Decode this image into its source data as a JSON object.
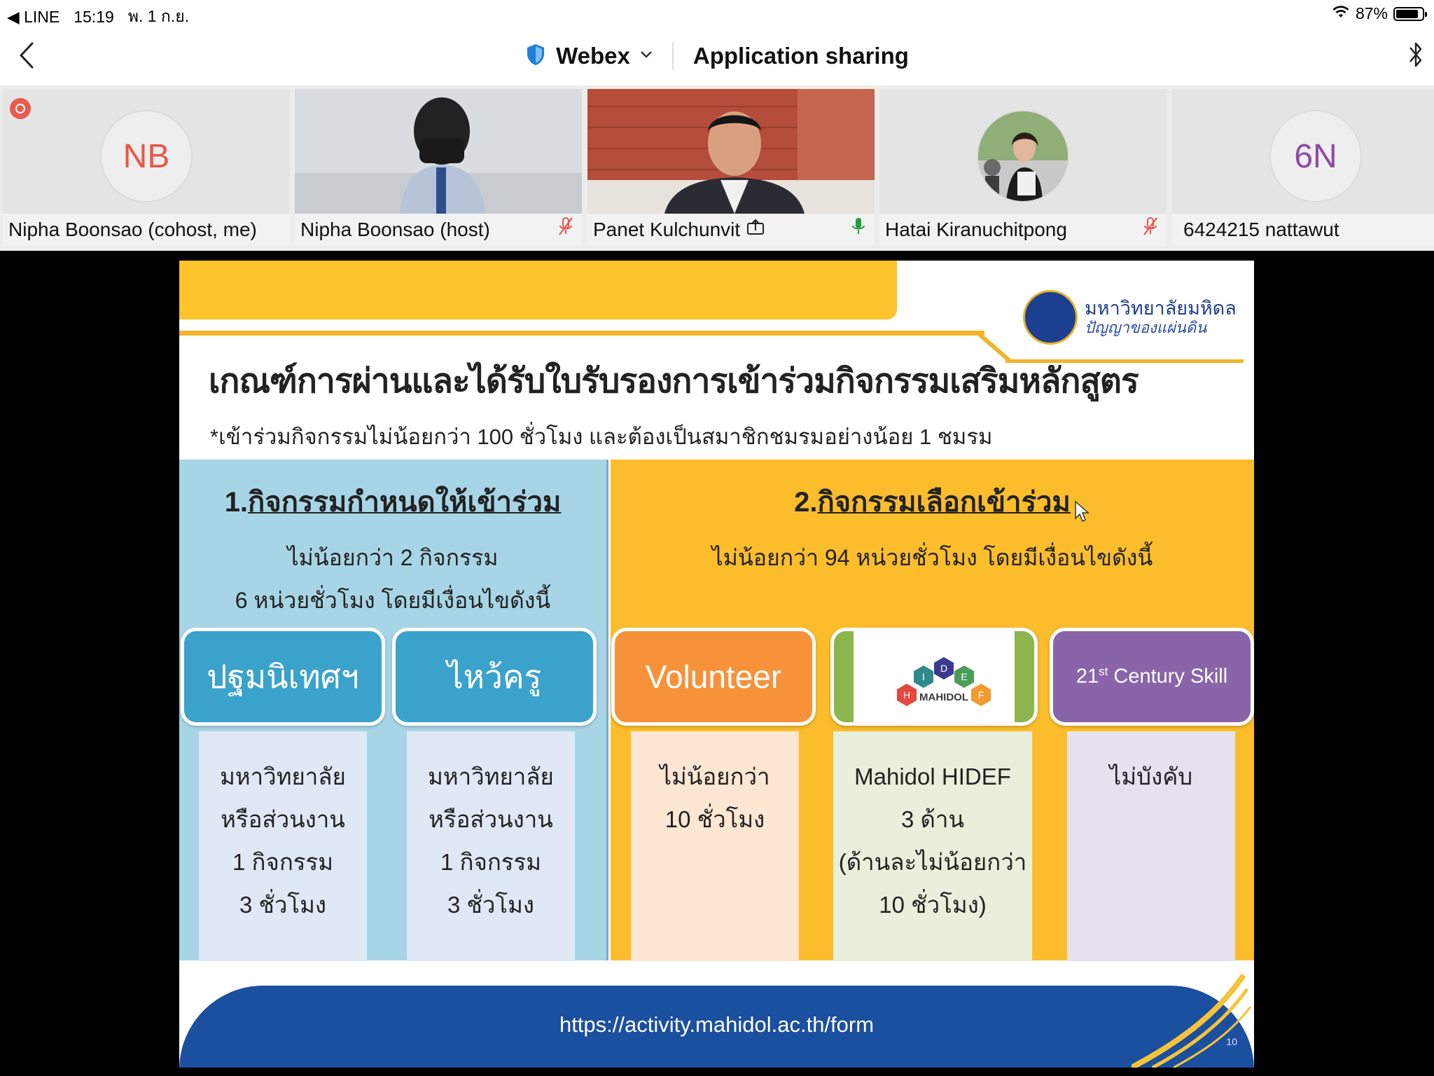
{
  "status_bar": {
    "back_app": "◀ LINE",
    "time": "15:19",
    "date": "พ. 1 ก.ย.",
    "battery_percent": "87%",
    "battery_level": 0.87
  },
  "nav": {
    "webex_label": "Webex",
    "title": "Application sharing"
  },
  "participants": [
    {
      "name": "Nipha Boonsao (cohost, me)",
      "initials": "NB",
      "initials_color": "#e8574a",
      "mic": "none",
      "recording": true
    },
    {
      "name": "Nipha Boonsao (host)",
      "initials": "",
      "mic": "muted"
    },
    {
      "name": "Panet Kulchunvit",
      "initials": "",
      "mic": "active",
      "sharing": true
    },
    {
      "name": "Hatai Kiranuchitpong",
      "initials": "",
      "mic": "muted"
    },
    {
      "name": "6424215 nattawut",
      "initials": "6N",
      "initials_color": "#8e4aa3",
      "mic": "none"
    }
  ],
  "slide": {
    "university_name": "มหาวิทยาลัยมหิดล",
    "university_motto": "ปัญญาของแผ่นดิน",
    "title": "เกณฑ์การผ่านและได้รับใบรับรองการเข้าร่วมกิจกรรมเสริมหลักสูตร",
    "subtitle": "*เข้าร่วมกิจกรรมไม่น้อยกว่า 100 ชั่วโมง และต้องเป็นสมาชิกชมรมอย่างน้อย 1 ชมรม",
    "section1": {
      "num": "1.",
      "heading": "กิจกรรมกำหนดให้เข้าร่วม",
      "line1": "ไม่น้อยกว่า 2 กิจกรรม",
      "line2": "6 หน่วยชั่วโมง โดยมีเงื่อนไขดังนี้"
    },
    "section2": {
      "num": "2.",
      "heading": "กิจกรรมเลือกเข้าร่วม",
      "line1": "ไม่น้อยกว่า 94 หน่วยชั่วโมง โดยมีเงื่อนไขดังนี้"
    },
    "boxes": [
      {
        "header": "ปฐมนิเทศฯ",
        "lines": [
          "มหาวิทยาลัย",
          "หรือส่วนงาน",
          "1 กิจกรรม",
          "3 ชั่วโมง"
        ]
      },
      {
        "header": "ไหว้ครู",
        "lines": [
          "มหาวิทยาลัย",
          "หรือส่วนงาน",
          "1 กิจกรรม",
          "3 ชั่วโมง"
        ]
      },
      {
        "header": "Volunteer",
        "lines": [
          "ไม่น้อยกว่า",
          "10 ชั่วโมง"
        ]
      },
      {
        "header_logo_letters": [
          "H",
          "I",
          "D",
          "E",
          "F"
        ],
        "header_logo_text": "MAHIDOL",
        "lines": [
          "Mahidol HIDEF",
          "3 ด้าน",
          "(ด้านละไม่น้อยกว่า",
          "10 ชั่วโมง)"
        ]
      },
      {
        "header_prefix": "21",
        "header_sup": "st",
        "header_rest": " Century Skill",
        "lines": [
          "ไม่บังคับ"
        ]
      }
    ],
    "footer_url": "https://activity.mahidol.ac.th/form",
    "page_number": "10"
  },
  "colors": {
    "slide_yellow": "#fbbd2b",
    "slide_blue_panel": "#a7d5e6",
    "box_blue": "#3ba2cc",
    "box_orange": "#f7923a",
    "box_green": "#8db54e",
    "box_purple": "#8a64a8",
    "footer_blue": "#1b4fa0"
  }
}
